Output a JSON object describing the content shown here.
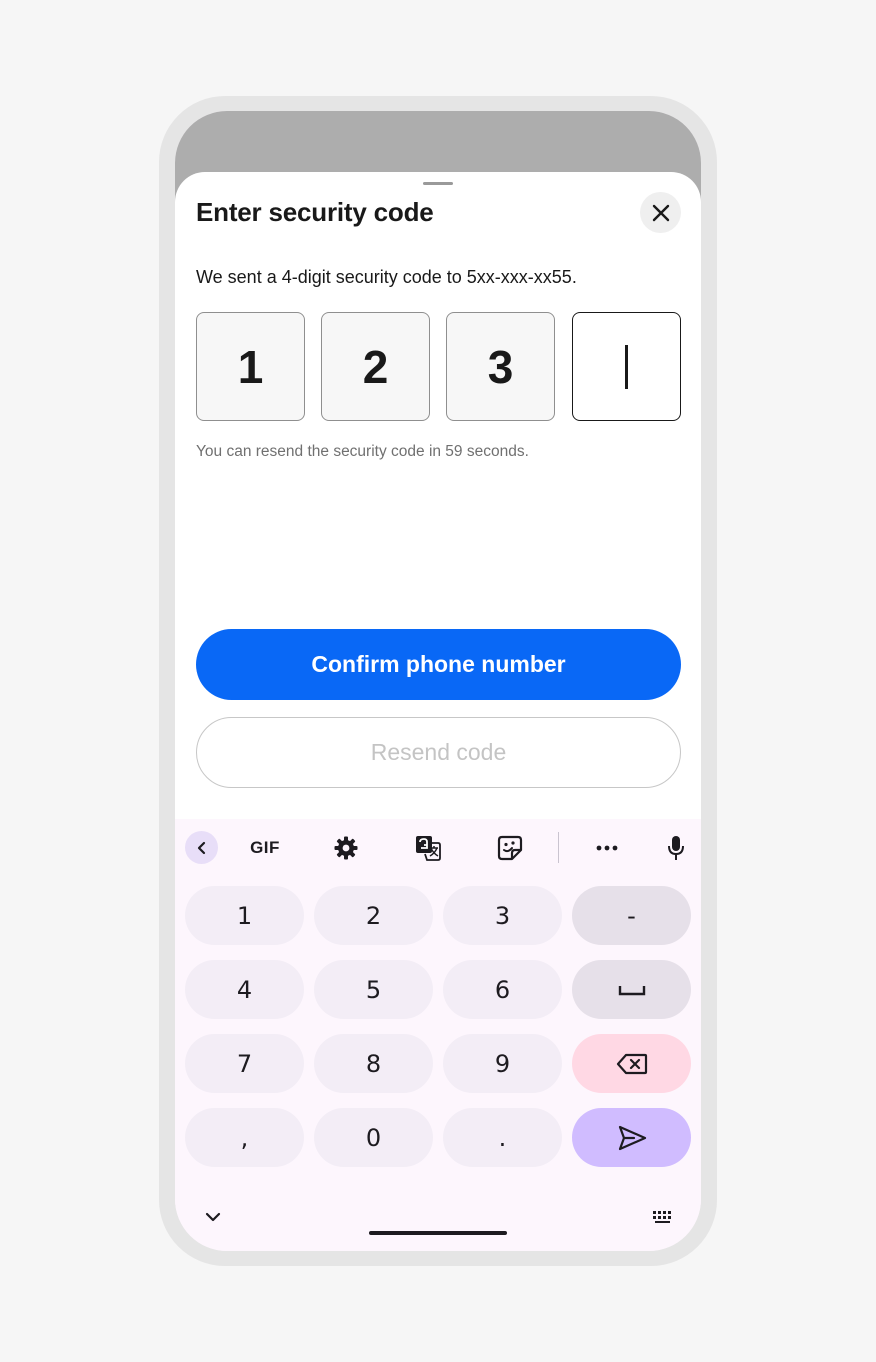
{
  "sheet": {
    "title": "Enter security code",
    "description": "We sent a 4-digit security code to 5xx-xxx-xx55.",
    "code_digits": [
      "1",
      "2",
      "3",
      ""
    ],
    "resend_note": "You can resend the security code in 59 seconds.",
    "confirm_label": "Confirm phone number",
    "resend_label": "Resend code",
    "close_icon": "close-icon"
  },
  "keyboard": {
    "gif_label": "GIF",
    "toolbar_icons": [
      "chevron-left-icon",
      "gear-icon",
      "translate-icon",
      "sticker-icon",
      "more-icon",
      "microphone-icon"
    ],
    "keys": {
      "k1": "1",
      "k2": "2",
      "k3": "3",
      "dash": "-",
      "k4": "4",
      "k5": "5",
      "k6": "6",
      "k7": "7",
      "k8": "8",
      "k9": "9",
      "comma": ",",
      "k0": "0",
      "period": "."
    },
    "special_icons": [
      "space-icon",
      "backspace-icon",
      "send-icon",
      "chevron-down-icon",
      "keyboard-switch-icon"
    ]
  },
  "colors": {
    "primary": "#0968f6",
    "scrim": "#adadad",
    "keyboard_bg": "#fdf6fd",
    "key_bg": "#f3edf6",
    "delete_key": "#ffd8e4",
    "enter_key": "#d0bcff"
  }
}
